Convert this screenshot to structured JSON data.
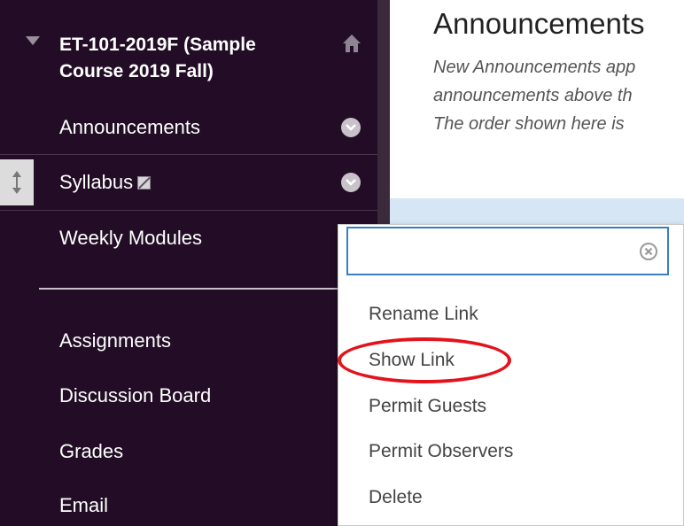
{
  "course": {
    "title_line1": "ET-101-2019F (Sample",
    "title_line2": "Course 2019 Fall)"
  },
  "sidebar": {
    "items": [
      {
        "label": "Announcements"
      },
      {
        "label": "Syllabus"
      },
      {
        "label": "Weekly Modules"
      },
      {
        "label": "Assignments"
      },
      {
        "label": "Discussion Board"
      },
      {
        "label": "Grades"
      },
      {
        "label": "Email"
      }
    ]
  },
  "content": {
    "heading": "Announcements",
    "desc_line1": "New Announcements app",
    "desc_line2": "announcements above th",
    "desc_line3": "The order shown here is"
  },
  "context_menu": {
    "search_value": "",
    "options": [
      {
        "label": "Rename Link"
      },
      {
        "label": "Show Link"
      },
      {
        "label": "Permit Guests"
      },
      {
        "label": "Permit Observers"
      },
      {
        "label": "Delete"
      }
    ]
  },
  "colors": {
    "sidebar_bg": "#230d26",
    "focus_border": "#3a7ec1",
    "highlight_ring": "#e3121b",
    "band": "#d7e6f5"
  },
  "icons": [
    "collapse-triangle-icon",
    "home-icon",
    "chevron-down-icon",
    "drag-handle-icon",
    "hidden-item-icon",
    "clear-icon"
  ]
}
